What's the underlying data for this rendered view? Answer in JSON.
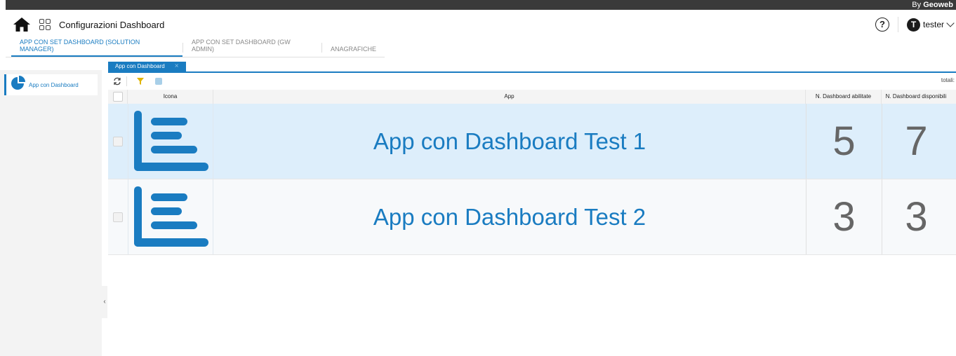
{
  "topbar": {
    "by_prefix": "By ",
    "brand": "Geoweb"
  },
  "header": {
    "title": "Configurazioni Dashboard",
    "help": "?",
    "user_initial": "T",
    "user_name": "tester"
  },
  "main_tabs": [
    {
      "label": "APP CON SET DASHBOARD (SOLUTION MANAGER)",
      "active": true
    },
    {
      "label": "APP CON SET DASHBOARD (GW ADMIN)",
      "active": false
    },
    {
      "label": "ANAGRAFICHE",
      "active": false
    }
  ],
  "sidebar": {
    "items": [
      {
        "label": "App con Dashboard",
        "icon": "pie-chart-icon"
      }
    ],
    "collapse": "‹"
  },
  "subtab": {
    "label": "App con Dashboard",
    "close": "×"
  },
  "toolbar": {
    "totals_label": "totali:"
  },
  "table": {
    "columns": [
      "Icona",
      "App",
      "N. Dashboard abilitate",
      "N. Dashboard disponibili"
    ],
    "rows": [
      {
        "app": "App con Dashboard Test 1",
        "enabled": "5",
        "available": "7",
        "selected": true
      },
      {
        "app": "App con Dashboard Test 2",
        "enabled": "3",
        "available": "3",
        "selected": false
      }
    ]
  },
  "colors": {
    "accent": "#1a7cc1",
    "topbar": "#3a3a3a",
    "selected_row": "#ddeefb"
  }
}
